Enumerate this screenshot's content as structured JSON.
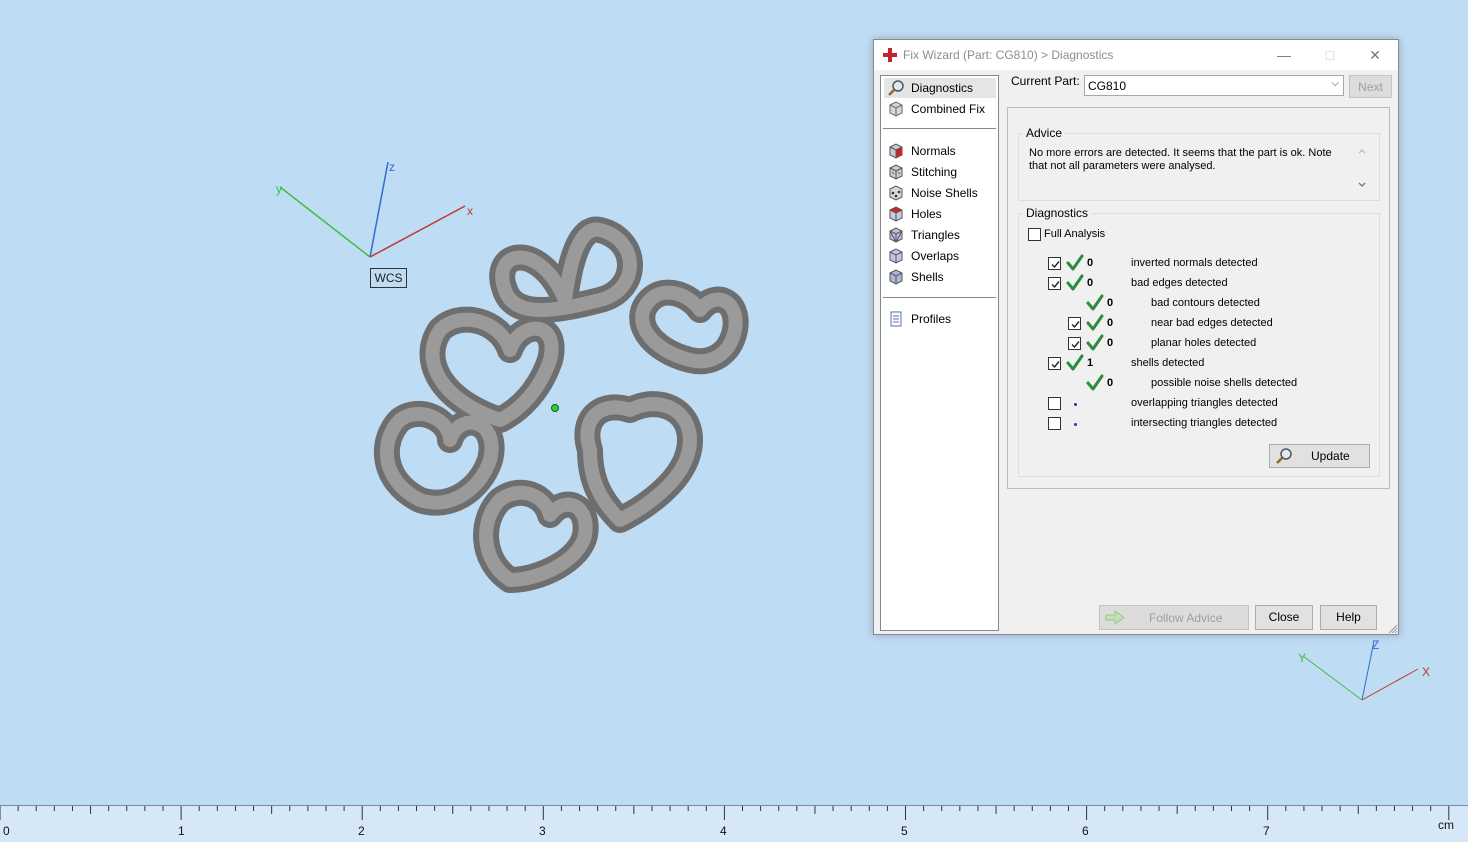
{
  "viewport": {
    "wcs_label": "WCS",
    "axis_labels": {
      "x": "x",
      "y": "y",
      "z": "z"
    },
    "mini_axis_labels": {
      "x": "X",
      "y": "Y",
      "z": "Z"
    },
    "colors": {
      "background": "#bfdcf5",
      "model": "#8a8a8a",
      "x_axis": "#c0392b",
      "y_axis": "#3fbf3f",
      "z_axis": "#2f6fcf"
    }
  },
  "ruler": {
    "numbers": [
      "0",
      "1",
      "2",
      "3",
      "4",
      "5",
      "6",
      "7"
    ],
    "unit": "cm"
  },
  "dialog": {
    "title": "Fix Wizard (Part: CG810) > Diagnostics",
    "sidebar": {
      "items": [
        {
          "label": "Diagnostics",
          "icon": "magnifier-icon",
          "selected": true
        },
        {
          "label": "Combined Fix",
          "icon": "cube-icon"
        },
        {
          "label": "Normals",
          "icon": "normals-cube-icon"
        },
        {
          "label": "Stitching",
          "icon": "stitching-cube-icon"
        },
        {
          "label": "Noise Shells",
          "icon": "noise-shells-icon"
        },
        {
          "label": "Holes",
          "icon": "holes-cube-icon"
        },
        {
          "label": "Triangles",
          "icon": "triangles-cube-icon"
        },
        {
          "label": "Overlaps",
          "icon": "overlaps-cube-icon"
        },
        {
          "label": "Shells",
          "icon": "shells-cube-icon"
        },
        {
          "label": "Profiles",
          "icon": "profiles-icon"
        }
      ]
    },
    "current_part_label": "Current Part:",
    "current_part_value": "CG810",
    "next_button": "Next",
    "advice": {
      "title": "Advice",
      "text": "No more errors are detected. It seems that the part is ok. Note that not all parameters were analysed."
    },
    "diagnostics": {
      "title": "Diagnostics",
      "full_analysis_label": "Full Analysis",
      "full_analysis_checked": false,
      "rows": [
        {
          "checkbox": true,
          "checked": true,
          "status": "ok",
          "count": "0",
          "label": "inverted normals detected",
          "indent": 0
        },
        {
          "checkbox": true,
          "checked": true,
          "status": "ok",
          "count": "0",
          "label": "bad edges detected",
          "indent": 0
        },
        {
          "checkbox": false,
          "checked": false,
          "status": "ok",
          "count": "0",
          "label": "bad contours detected",
          "indent": 1
        },
        {
          "checkbox": true,
          "checked": true,
          "status": "ok",
          "count": "0",
          "label": "near bad edges detected",
          "indent": 1
        },
        {
          "checkbox": true,
          "checked": true,
          "status": "ok",
          "count": "0",
          "label": "planar holes detected",
          "indent": 1
        },
        {
          "checkbox": true,
          "checked": true,
          "status": "ok",
          "count": "1",
          "label": "shells detected",
          "indent": 0
        },
        {
          "checkbox": false,
          "checked": false,
          "status": "ok",
          "count": "0",
          "label": "possible noise shells detected",
          "indent": 1
        },
        {
          "checkbox": true,
          "checked": false,
          "status": "none",
          "count": "",
          "label": "overlapping triangles detected",
          "indent": 0
        },
        {
          "checkbox": true,
          "checked": false,
          "status": "none",
          "count": "",
          "label": "intersecting triangles detected",
          "indent": 0
        }
      ],
      "update_button": "Update"
    },
    "follow_advice_button": "Follow Advice",
    "close_button": "Close",
    "help_button": "Help"
  }
}
